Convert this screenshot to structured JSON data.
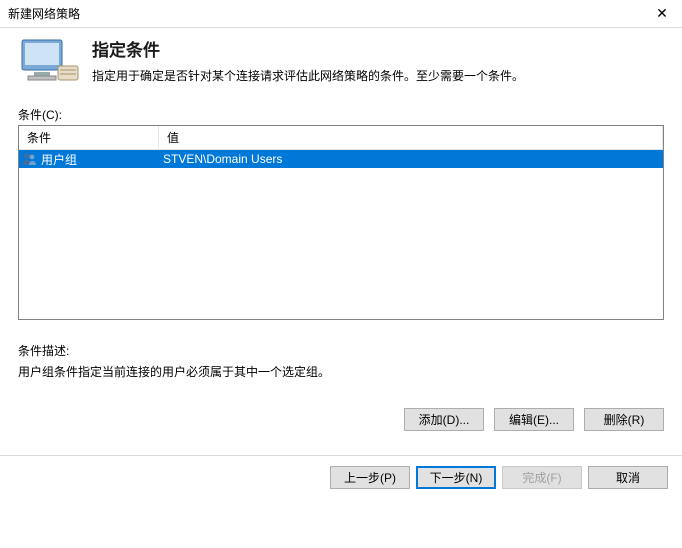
{
  "window": {
    "title": "新建网络策略"
  },
  "header": {
    "title": "指定条件",
    "subtitle": "指定用于确定是否针对某个连接请求评估此网络策略的条件。至少需要一个条件。"
  },
  "conditions": {
    "label": "条件(C):",
    "columns": {
      "condition": "条件",
      "value": "值"
    },
    "rows": [
      {
        "condition": "用户组",
        "value": "STVEN\\Domain Users",
        "selected": true
      }
    ]
  },
  "description": {
    "label": "条件描述:",
    "text": "用户组条件指定当前连接的用户必须属于其中一个选定组。"
  },
  "buttons": {
    "add": "添加(D)...",
    "edit": "编辑(E)...",
    "remove": "删除(R)",
    "prev": "上一步(P)",
    "next": "下一步(N)",
    "finish": "完成(F)",
    "cancel": "取消"
  }
}
